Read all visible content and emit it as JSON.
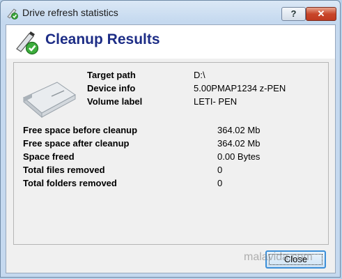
{
  "window": {
    "title": "Drive refresh statistics"
  },
  "titlebar_buttons": {
    "help": "?",
    "close": "✕"
  },
  "header": {
    "title": "Cleanup Results"
  },
  "device": {
    "target_path_label": "Target path",
    "target_path_value": "D:\\",
    "device_info_label": "Device info",
    "device_info_value": "5.00PMAP1234 z-PEN",
    "volume_label_label": "Volume label",
    "volume_label_value": "LETI- PEN"
  },
  "stats": [
    {
      "label": "Free space before cleanup",
      "value": "364.02 Mb"
    },
    {
      "label": "Free space after cleanup",
      "value": "364.02 Mb"
    },
    {
      "label": "Space freed",
      "value": "0.00 Bytes"
    },
    {
      "label": "Total files removed",
      "value": "0"
    },
    {
      "label": "Total folders removed",
      "value": "0"
    }
  ],
  "footer": {
    "close_label": "Close"
  },
  "watermark": "malavida.com"
}
